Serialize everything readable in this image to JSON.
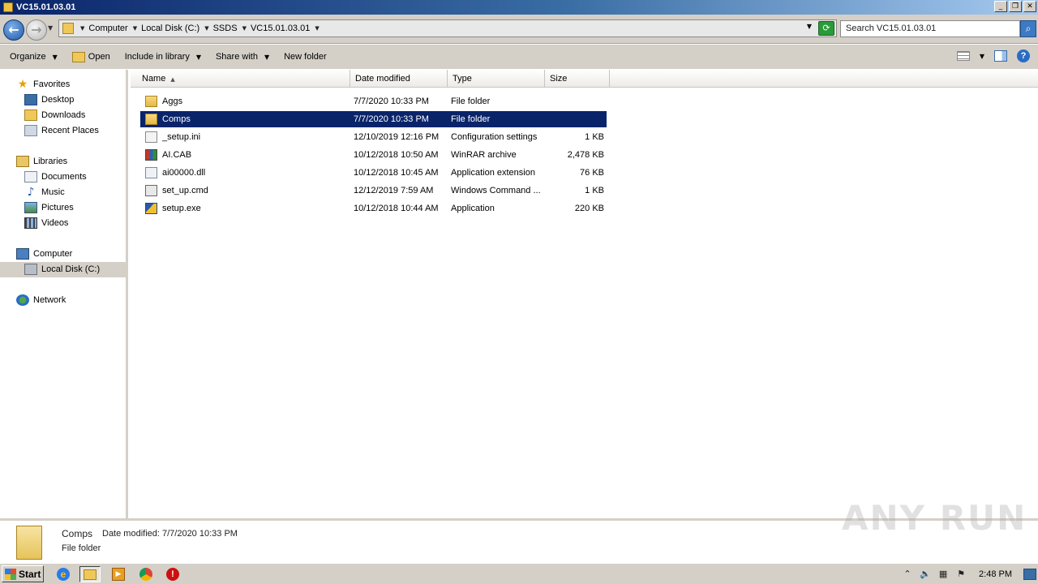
{
  "window": {
    "title": "VC15.01.03.01",
    "controls": {
      "minimize": "_",
      "maximize": "❐",
      "close": "✕"
    }
  },
  "address": {
    "breadcrumbs": [
      "Computer",
      "Local Disk (C:)",
      "SSDS",
      "VC15.01.03.01"
    ],
    "search_placeholder": "Search VC15.01.03.01"
  },
  "toolbar": {
    "organize": "Organize",
    "open": "Open",
    "include_in_library": "Include in library",
    "share_with": "Share with",
    "new_folder": "New folder"
  },
  "nav": {
    "favorites": "Favorites",
    "desktop": "Desktop",
    "downloads": "Downloads",
    "recent_places": "Recent Places",
    "libraries": "Libraries",
    "documents": "Documents",
    "music": "Music",
    "pictures": "Pictures",
    "videos": "Videos",
    "computer": "Computer",
    "local_disk": "Local Disk (C:)",
    "network": "Network"
  },
  "columns": {
    "name": "Name",
    "date": "Date modified",
    "type": "Type",
    "size": "Size"
  },
  "files": [
    {
      "name": "Aggs",
      "date": "7/7/2020 10:33 PM",
      "type": "File folder",
      "size": "",
      "icon": "folder-icon"
    },
    {
      "name": "Comps",
      "date": "7/7/2020 10:33 PM",
      "type": "File folder",
      "size": "",
      "icon": "folder-icon",
      "selected": true
    },
    {
      "name": "_setup.ini",
      "date": "12/10/2019 12:16 PM",
      "type": "Configuration settings",
      "size": "1 KB",
      "icon": "ini-file-icon"
    },
    {
      "name": "AI.CAB",
      "date": "10/12/2018 10:50 AM",
      "type": "WinRAR archive",
      "size": "2,478 KB",
      "icon": "winrar-archive-icon"
    },
    {
      "name": "ai00000.dll",
      "date": "10/12/2018 10:45 AM",
      "type": "Application extension",
      "size": "76 KB",
      "icon": "dll-file-icon"
    },
    {
      "name": "set_up.cmd",
      "date": "12/12/2019 7:59 AM",
      "type": "Windows Command ...",
      "size": "1 KB",
      "icon": "cmd-file-icon"
    },
    {
      "name": "setup.exe",
      "date": "10/12/2018 10:44 AM",
      "type": "Application",
      "size": "220 KB",
      "icon": "exe-file-icon"
    }
  ],
  "details": {
    "name": "Comps",
    "modified_label": "Date modified: 7/7/2020 10:33 PM",
    "type": "File folder"
  },
  "watermark": "ANY RUN",
  "taskbar": {
    "start": "Start",
    "clock": "2:48 PM"
  },
  "colors": {
    "selection": "#0a246a",
    "titlebar": "#0a246a",
    "chrome": "#d4d0c8"
  }
}
